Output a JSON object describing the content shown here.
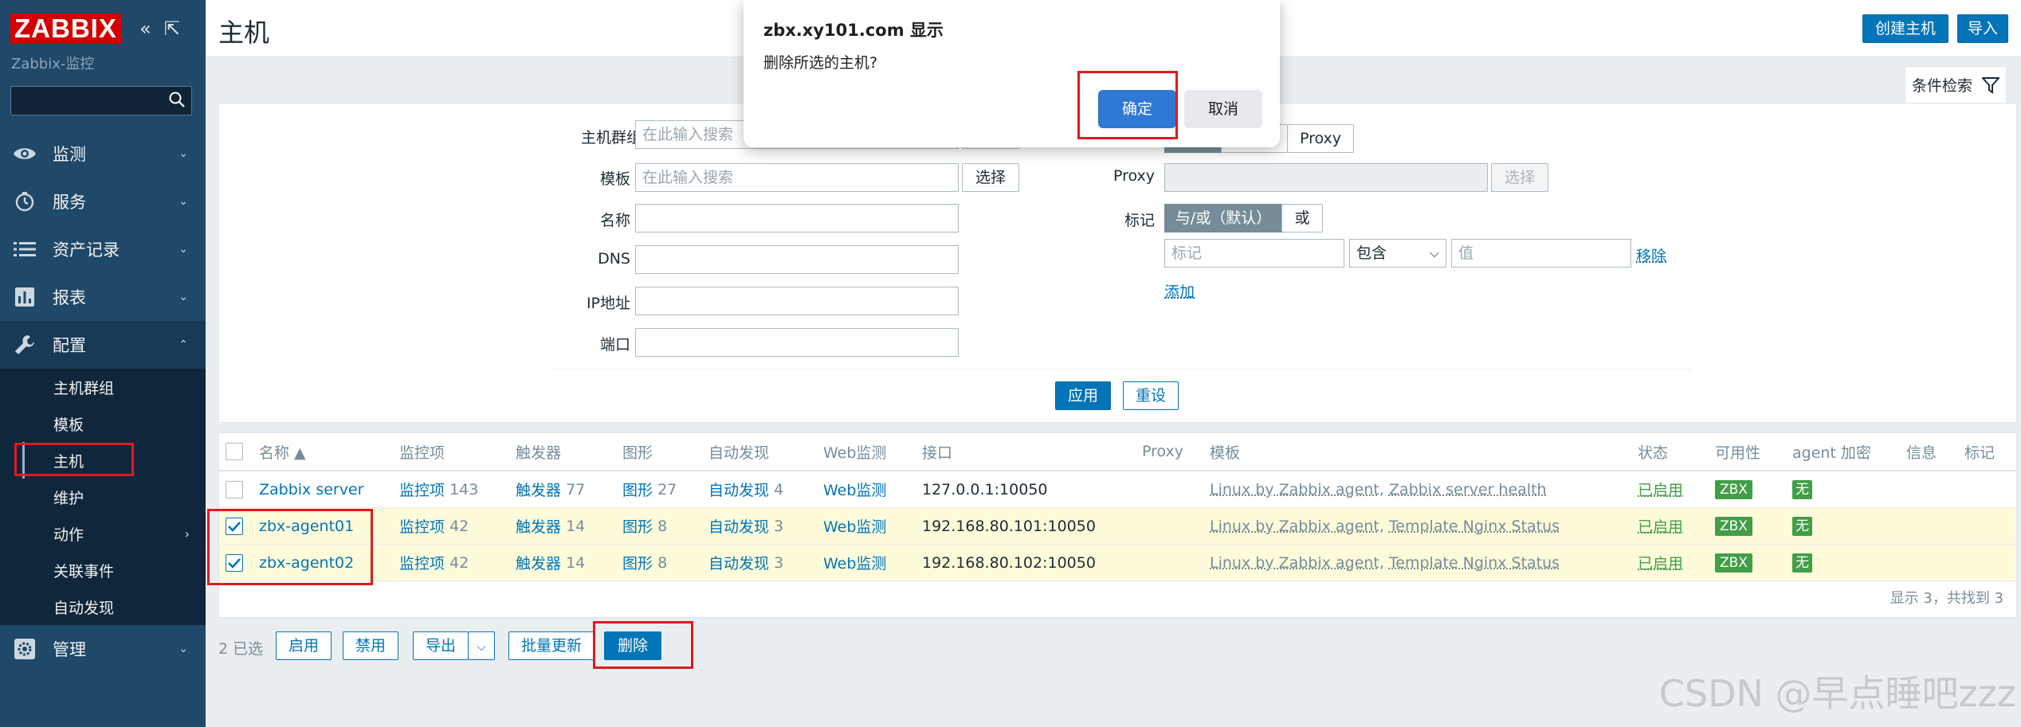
{
  "app": {
    "logo": "ZABBIX",
    "subtitle": "Zabbix-监控",
    "search_value": ""
  },
  "sidebar": {
    "menu": [
      {
        "label": "监测",
        "icon": "eye-icon"
      },
      {
        "label": "服务",
        "icon": "clock-icon"
      },
      {
        "label": "资产记录",
        "icon": "list-icon"
      },
      {
        "label": "报表",
        "icon": "chart-icon"
      },
      {
        "label": "配置",
        "icon": "wrench-icon"
      },
      {
        "label": "管理",
        "icon": "gear-icon"
      }
    ],
    "submenu": [
      {
        "label": "主机群组"
      },
      {
        "label": "模板"
      },
      {
        "label": "主机"
      },
      {
        "label": "维护"
      },
      {
        "label": "动作"
      },
      {
        "label": "关联事件"
      },
      {
        "label": "自动发现"
      }
    ]
  },
  "header": {
    "title": "主机",
    "create_host": "创建主机",
    "import": "导入"
  },
  "filter": {
    "tab_label": "条件检索",
    "host_groups_label": "主机群组",
    "host_groups_placeholder": "在此输入搜索",
    "templates_label": "模板",
    "templates_placeholder": "在此输入搜索",
    "select_label": "选择",
    "name_label": "名称",
    "dns_label": "DNS",
    "ip_label": "IP地址",
    "port_label": "端口",
    "proxy_segment": "Proxy",
    "proxy_label": "Proxy",
    "proxy_select": "选择",
    "tags_label": "标记",
    "tags_andor": "与/或（默认）",
    "tags_or": "或",
    "tag_placeholder": "标记",
    "tag_operator": "包含",
    "tag_value_placeholder": "值",
    "remove_link": "移除",
    "add_link": "添加",
    "apply": "应用",
    "reset": "重设"
  },
  "table": {
    "columns": [
      "名称 ▲",
      "监控项",
      "触发器",
      "图形",
      "自动发现",
      "Web监测",
      "接口",
      "Proxy",
      "模板",
      "状态",
      "可用性",
      "agent 加密",
      "信息",
      "标记"
    ],
    "rows": [
      {
        "name": "Zabbix server",
        "items": "监控项",
        "items_n": "143",
        "triggers": "触发器",
        "triggers_n": "77",
        "graphs": "图形",
        "graphs_n": "27",
        "discovery": "自动发现",
        "discovery_n": "4",
        "web": "Web监测",
        "interface": "127.0.0.1:10050",
        "tpl1": "Linux by Zabbix agent",
        "tpl2": "Zabbix server health",
        "status": "已启用",
        "avail": "ZBX",
        "enc": "无",
        "checked": false
      },
      {
        "name": "zbx-agent01",
        "items": "监控项",
        "items_n": "42",
        "triggers": "触发器",
        "triggers_n": "14",
        "graphs": "图形",
        "graphs_n": "8",
        "discovery": "自动发现",
        "discovery_n": "3",
        "web": "Web监测",
        "interface": "192.168.80.101:10050",
        "tpl1": "Linux by Zabbix agent",
        "tpl2": "Template Nginx Status",
        "status": "已启用",
        "avail": "ZBX",
        "enc": "无",
        "checked": true
      },
      {
        "name": "zbx-agent02",
        "items": "监控项",
        "items_n": "42",
        "triggers": "触发器",
        "triggers_n": "14",
        "graphs": "图形",
        "graphs_n": "8",
        "discovery": "自动发现",
        "discovery_n": "3",
        "web": "Web监测",
        "interface": "192.168.80.102:10050",
        "tpl1": "Linux by Zabbix agent",
        "tpl2": "Template Nginx Status",
        "status": "已启用",
        "avail": "ZBX",
        "enc": "无",
        "checked": true
      }
    ],
    "footer": "显示 3，共找到 3"
  },
  "actions": {
    "selected": "2 已选",
    "enable": "启用",
    "disable": "禁用",
    "export": "导出",
    "mass_update": "批量更新",
    "delete": "删除"
  },
  "dialog": {
    "title": "zbx.xy101.com 显示",
    "message": "删除所选的主机?",
    "ok": "确定",
    "cancel": "取消"
  },
  "watermark": "CSDN @早点睡吧zzz"
}
